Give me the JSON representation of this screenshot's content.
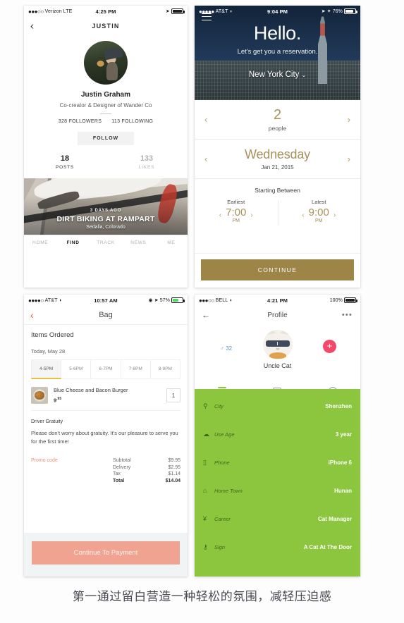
{
  "caption": "第一通过留白营造一种轻松的氛围，减轻压迫感",
  "colors": {
    "gold": "#a8915c",
    "gold_button": "#9c8547",
    "green": "#8cc63e",
    "coral": "#f0a391",
    "promo_coral": "#eb8f7b",
    "pink": "#f4486b",
    "slot_underline": "#e2c047"
  },
  "panel1": {
    "status": {
      "dots": "●●●○○",
      "carrier": "Verizon",
      "network": "LTE",
      "time": "4:25 PM",
      "battery": ""
    },
    "nav": {
      "back_icon": "chevron-left-icon",
      "title": "JUSTIN"
    },
    "profile": {
      "avatar_alt": "justin-avatar",
      "name": "Justin Graham",
      "subtitle": "Co-creator & Designer of Wander Co",
      "followers": "328 FOLLOWERS",
      "following": "113 FOLLOWING",
      "follow_button": "FOLLOW"
    },
    "stats": [
      {
        "num": "18",
        "label": "POSTS",
        "muted": false
      },
      {
        "num": "133",
        "label": "LIKES",
        "muted": true
      }
    ],
    "photo_card": {
      "ago": "3 DAYS AGO",
      "title": "DIRT BIKING AT RAMPART",
      "location": "Sedalia, Colorado"
    },
    "tabs": [
      {
        "label": "HOME",
        "active": false
      },
      {
        "label": "FIND",
        "active": true
      },
      {
        "label": "TRACK",
        "active": false
      },
      {
        "label": "NEWS",
        "active": false
      },
      {
        "label": "ME",
        "active": false
      }
    ]
  },
  "panel2": {
    "status": {
      "dots": "●●●●●",
      "carrier": "AT&T",
      "wifi": "wifi-icon",
      "time": "9:04 PM",
      "bluetooth": "bluetooth-icon",
      "battery_pct": "76%"
    },
    "hero": {
      "menu_icon": "hamburger-menu-icon",
      "headline": "Hello.",
      "tagline": "Let's get you a reservation.",
      "city": "New York City",
      "city_caret": "chevron-down-icon"
    },
    "people": {
      "value": "2",
      "label": "people",
      "prev_icon": "chevron-left-icon",
      "next_icon": "chevron-right-icon"
    },
    "date": {
      "day": "Wednesday",
      "date": "Jan 21, 2015",
      "prev_icon": "chevron-left-icon",
      "next_icon": "chevron-right-icon"
    },
    "starting_between_label": "Starting Between",
    "times": [
      {
        "label": "Earliest",
        "value": "7:00",
        "meridiem": "PM"
      },
      {
        "label": "Latest",
        "value": "9:00",
        "meridiem": "PM"
      }
    ],
    "continue_button": "CONTINUE"
  },
  "panel3": {
    "status": {
      "dots": "●●●●○",
      "carrier": "AT&T",
      "wifi": "wifi-icon",
      "time": "10:57 AM",
      "battery_pct": "57%"
    },
    "nav": {
      "back_icon": "chevron-left-icon",
      "title": "Bag"
    },
    "items_ordered_heading": "Items Ordered",
    "today_label": "Today, May 28",
    "slots": [
      {
        "label": "4-5PM",
        "active": true
      },
      {
        "label": "5-6PM",
        "active": false
      },
      {
        "label": "6-7PM",
        "active": false
      },
      {
        "label": "7-8PM",
        "active": false
      },
      {
        "label": "8-9PM",
        "active": false
      }
    ],
    "item": {
      "name": "Blue Cheese and Bacon Burger",
      "price_main": "9",
      "price_cents": ".95",
      "qty": "1"
    },
    "gratuity": {
      "heading": "Driver Gratuity",
      "body": "Please don't worry about gratuity. It's our pleasure to serve you for the first time!"
    },
    "promo_code": "Promo code",
    "totals": [
      {
        "label": "Subtotal",
        "value": "$9.95",
        "bold": false
      },
      {
        "label": "Delivery",
        "value": "$2.95",
        "bold": false
      },
      {
        "label": "Tax",
        "value": "$1.14",
        "bold": false
      },
      {
        "label": "Total",
        "value": "$14.04",
        "bold": true
      }
    ],
    "pay_button": "Continue To Payment"
  },
  "panel4": {
    "status": {
      "dots": "●●●○○",
      "carrier": "BELL",
      "wifi": "wifi-icon",
      "time": "4:21 PM",
      "battery_pct": "100%"
    },
    "nav": {
      "back_icon": "arrow-left-icon",
      "title": "Profile",
      "more_icon": "more-horizontal-icon"
    },
    "profile": {
      "avatar_alt": "uncle-cat-avatar",
      "name": "Uncle Cat",
      "gender_icon": "male-icon",
      "age": "32",
      "add_button": "+"
    },
    "tabs": [
      {
        "icon": "list-icon",
        "active": true
      },
      {
        "icon": "photo-icon",
        "active": false
      },
      {
        "icon": "history-icon",
        "active": false
      }
    ],
    "rows": [
      {
        "icon": "location-pin-icon",
        "label": "City",
        "value": "Shenzhen"
      },
      {
        "icon": "cloud-icon",
        "label": "Use Age",
        "value": "3 year"
      },
      {
        "icon": "phone-icon",
        "label": "Phone",
        "value": "iPhone 6"
      },
      {
        "icon": "home-icon",
        "label": "Home Town",
        "value": "Hunan"
      },
      {
        "icon": "yen-icon",
        "label": "Career",
        "value": "Cat Manager"
      },
      {
        "icon": "key-icon",
        "label": "Sign",
        "value": "A Cat At The Door"
      }
    ]
  }
}
